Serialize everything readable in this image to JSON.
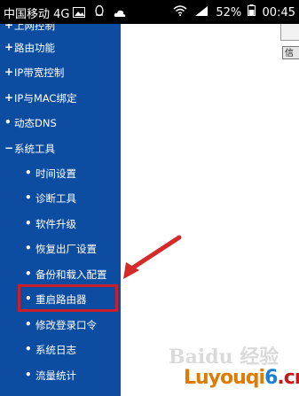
{
  "status_bar": {
    "carrier": "中国移动 4G",
    "battery": "52%",
    "time": "00:45",
    "icons": [
      "image-icon",
      "qq-icon",
      "cloud-icon",
      "wifi-icon",
      "signal-icon",
      "battery-icon"
    ]
  },
  "sidebar": {
    "items": [
      {
        "label": "上网控制",
        "bullet": "+",
        "level": 1
      },
      {
        "label": "路由功能",
        "bullet": "+",
        "level": 1
      },
      {
        "label": "IP带宽控制",
        "bullet": "+",
        "level": 1
      },
      {
        "label": "IP与MAC绑定",
        "bullet": "+",
        "level": 1
      },
      {
        "label": "动态DNS",
        "bullet": "•",
        "level": 1
      },
      {
        "label": "系统工具",
        "bullet": "−",
        "level": 1
      },
      {
        "label": "时间设置",
        "bullet": "•",
        "level": 2
      },
      {
        "label": "诊断工具",
        "bullet": "•",
        "level": 2
      },
      {
        "label": "软件升级",
        "bullet": "•",
        "level": 2
      },
      {
        "label": "恢复出厂设置",
        "bullet": "•",
        "level": 2
      },
      {
        "label": "备份和载入配置",
        "bullet": "•",
        "level": 2
      },
      {
        "label": "重启路由器",
        "bullet": "•",
        "level": 2
      },
      {
        "label": "修改登录口令",
        "bullet": "•",
        "level": 2
      },
      {
        "label": "系统日志",
        "bullet": "•",
        "level": 2
      },
      {
        "label": "流量统计",
        "bullet": "•",
        "level": 2
      }
    ]
  },
  "main": {
    "button_partial": "信"
  },
  "overlays": {
    "highlight_color": "#c8202a",
    "watermark": "Baidu 经验",
    "site_part1": "Luyouqi",
    "site_part2": "6",
    "site_part3": ".cn"
  },
  "colors": {
    "sidebar_bg": "#0c4da2",
    "status_bg": "#000000",
    "text": "#ffffff"
  }
}
